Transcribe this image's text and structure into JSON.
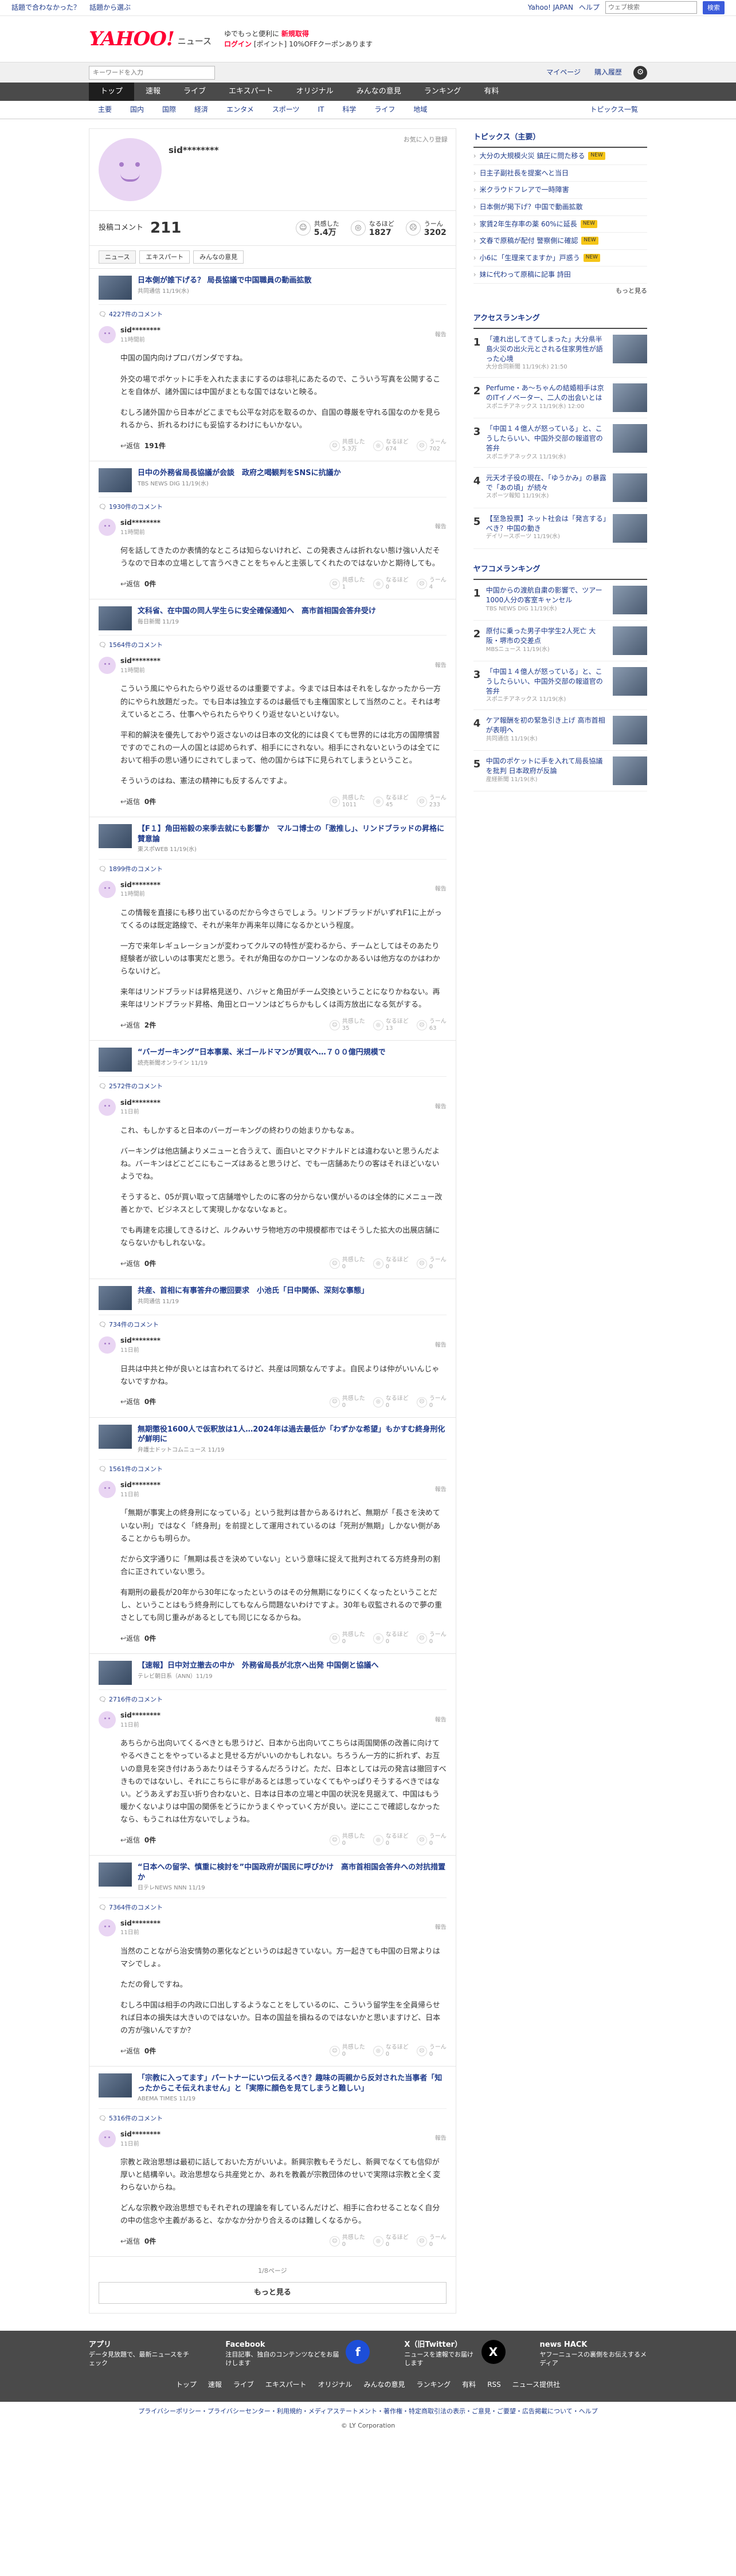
{
  "topbar": {
    "help1": "話題で合わなかった？",
    "help2": "話題から選ぶ",
    "right1": "Yahoo! JAPAN",
    "right2": "ヘルプ",
    "search_placeholder": "ウェブ検索",
    "search_btn": "検索"
  },
  "header": {
    "logo": "YAHOO!",
    "logo_sub": "ニュース",
    "promo1": "ゆでもっと便利に",
    "promo1b": "新規取得",
    "promo2": "ログイン",
    "promo2b": "[ポイント]",
    "promo2c": "10%OFFクーポンあります"
  },
  "searchbar": {
    "placeholder": "キーワードを入力",
    "my_page": "マイページ",
    "buy": "購入履歴"
  },
  "gnav": [
    "トップ",
    "速報",
    "ライブ",
    "エキスパート",
    "オリジナル",
    "みんなの意見",
    "ランキング",
    "有料"
  ],
  "snav": [
    "主要",
    "国内",
    "国際",
    "経済",
    "エンタメ",
    "スポーツ",
    "IT",
    "科学",
    "ライフ",
    "地域"
  ],
  "snav_right": "トピックス一覧",
  "profile": {
    "name": "sid********",
    "follow": "お気に入り登録",
    "posts_label": "投稿コメント",
    "posts": "211",
    "agree_label": "共感した",
    "agree": "5.4万",
    "hmm_label": "なるほど",
    "hmm": "1827",
    "bad_label": "うーん",
    "bad": "3202"
  },
  "tabs": [
    "ニュース",
    "エキスパート",
    "みんなの意見"
  ],
  "entries": [
    {
      "title": "日本側が誰下げる？ 局長協議で中国職員の動画拡散",
      "source": "共同通信 11/19(水)",
      "ccount": "4227件のコメント",
      "user": "sid********",
      "time": "11時間前",
      "report": "報告",
      "paras": [
        "中国の国内向けプロパガンダですね。",
        "外交の場でポケットに手を入れたままにするのは非礼にあたるので、こういう写真を公開することを自体が、諸外国には中国がまともな国ではないと映る。",
        "むしろ諸外国から日本がどこまでも公平な対応を取るのか、自国の尊厳を守れる国なのかを見られるから、折れるわけにも妥協するわけにもいかない。"
      ],
      "replies": "191件",
      "agree": "5.3万",
      "hmm": "674",
      "bad": "702"
    },
    {
      "title": "日中の外務省局長協議が会談　政府之喝観判をSNSに抗議か",
      "source": "TBS NEWS DIG 11/19(水)",
      "ccount": "1930件のコメント",
      "user": "sid********",
      "time": "11時間前",
      "report": "報告",
      "paras": [
        "何を話してきたのか表情的なところは知らないけれど、この発表さんは折れない態け強い人だそうなので日本の立場として言うべきことをちゃんと主張してくれたのではないかと期待しても。"
      ],
      "replies": "0件",
      "agree": "1",
      "hmm": "0",
      "bad": "4"
    },
    {
      "title": "文科省、在中国の同人学生らに安全確保通知へ　高市首相国会答弁受け",
      "source": "毎日新聞 11/19",
      "ccount": "1564件のコメント",
      "user": "sid********",
      "time": "11時間前",
      "report": "報告",
      "paras": [
        "こういう風にやられたらやり返せるのは重要ですよ。今までは日本はそれをしなかったから一方的にやられ放題だった。でも日本は独立するのは最低でも主権国家として当然のこと。それは考えているところ、仕事へやられたらやりくり返せないといけない。",
        "平和的解決を優先しておやり返さないのは日本の文化的には良くても世界的には北方の国際慣習ですのでこれの一人の国とは認められず、相手ににされない。相手にされないというのは全てにおいて相手の思い通りにされてしまって、他の国からは下に見られてしまうということ。",
        "そういうのはね、憲法の精神にも反するんですよ。"
      ],
      "replies": "0件",
      "agree": "1011",
      "hmm": "45",
      "bad": "233"
    },
    {
      "title": "【F１】角田裕毅の来季去就にも影響か　マルコ博士の「激推し」、リンドブラッドの昇格に賛意論",
      "source": "東スポWEB 11/19(水)",
      "ccount": "1899件のコメント",
      "user": "sid********",
      "time": "11時間前",
      "report": "報告",
      "paras": [
        "この情報を直接にも移り出ているのだから今さらでしょう。リンドブラッドがいずれF1に上がってくるのは既定路線で、それが来年か再来年以降になるかという程度。",
        "一方で来年レギュレーションが変わってクルマの特性が変わるから、チームとしてはそのあたり経験者が欲しいのは事実だと思う。それが角田なのかローソンなのかあるいは他方なのかはわからないけど。",
        "来年はリンドブラッドは昇格見送り、ハジャと角田がチーム交換ということになりかねない。再来年はリンドブラッド昇格、角田とローソンはどちらかもしくは両方放出になる気がする。"
      ],
      "replies": "2件",
      "agree": "35",
      "hmm": "13",
      "bad": "63"
    },
    {
      "title": "“バーガーキング”日本事業、米ゴールドマンが買収へ…７００億円規模で",
      "source": "読売新聞オンライン 11/19",
      "ccount": "2572件のコメント",
      "user": "sid********",
      "time": "11日前",
      "report": "報告",
      "paras": [
        "これ、もしかすると日本のバーガーキングの終わりの始まりかもなぁ。",
        "バーキングは他店舗よりメニューと合うえて、面白いとマクドナルドとは違わないと思うんだよね。バーキンはどこどこにもこーズはあると思うけど、でも一店舗あたりの客はそれほどいないようでね。",
        "そうすると、05が買い取って店舗増やしたのに客の分からない僕がいるのは全体的にメニュー改善とかで、ビジネスとして実現しかなないなぁと。",
        "でも再建を応援してきるけど、ルクみいサラ物地方の中規模都市ではそうした拡大の出展店舗にならないかもしれないな。"
      ],
      "replies": "0件",
      "agree": "0",
      "hmm": "0",
      "bad": "0"
    },
    {
      "title": "共産、首相に有事答弁の撤回要求　小池氏「日中関係、深刻な事態」",
      "source": "共同通信 11/19",
      "ccount": "734件のコメント",
      "user": "sid********",
      "time": "11日前",
      "report": "報告",
      "paras": [
        "日共は中共と仲が良いとは言われてるけど、共産は同類なんですよ。自民よりは仲がいいんじゃないですかね。"
      ],
      "replies": "0件",
      "agree": "0",
      "hmm": "0",
      "bad": "0"
    },
    {
      "title": "無期懲役1600人で仮釈放は1人…2024年は過去最低か「わずかな希望」もかすむ終身刑化が鮮明に",
      "source": "弁護士ドットコムニュース 11/19",
      "ccount": "1561件のコメント",
      "user": "sid********",
      "time": "11日前",
      "report": "報告",
      "paras": [
        "「無期が事実上の終身刑になっている」という批判は昔からあるけれど、無期が「長さを決めていない刑」ではなく「終身刑」を前提として運用されているのは「死刑が無期」しかない側があることからも明らか。",
        "だから文字通りに「無期は長さを決めていない」という意味に捉えて批判されてる方終身刑の割合に正されていない思う。",
        "有期刑の最長が20年から30年になったというのはその分無期になりにくくなったということだし、ということはもう終身刑にしてもなんら問題ないわけですよ。30年も収監されるので夢の重さとしても同じ重みがあるとしても同じになるからね。"
      ],
      "replies": "0件",
      "agree": "0",
      "hmm": "0",
      "bad": "0"
    },
    {
      "title": "【速報】日中対立撤去の中か　外務省局長が北京へ出発 中国側と協議へ",
      "source": "テレビ朝日系（ANN）11/19",
      "ccount": "2716件のコメント",
      "user": "sid********",
      "time": "11日前",
      "report": "報告",
      "paras": [
        "あちらから出向いてくるべきとも思うけど、日本から出向いてこちらは両国関係の改善に向けてやるべきことをやっているよと見せる方がいいのかもしれない。ちろうん一方的に折れず、お互いの意見を突き付けあうあたりはそうするんだろうけど。ただ、日本としては元の発言は撤回すべきものではないし、それにこちらに非があるとは思っていなくてもやっぱりそうするべきではない。どうあえずお互い折り合わないと、日本は日本の立場と中国の状況を見据えて、中国はもう暖かくないよりは中国の関係をどうにかうまくやっていく方が良い。逆にここで確認しなかったなら、もうこれは仕方ないでしょうね。"
      ],
      "replies": "0件",
      "agree": "0",
      "hmm": "0",
      "bad": "0"
    },
    {
      "title": "“日本への留学、慎重に検討を”中国政府が国民に呼びかけ　高市首相国会答弁への対抗措置か",
      "source": "日テレNEWS NNN 11/19",
      "ccount": "7364件のコメント",
      "user": "sid********",
      "time": "11日前",
      "report": "報告",
      "paras": [
        "当然のことながら治安情勢の悪化などというのは起きていない。方一起きても中国の日常よりはマシでしょ。",
        "ただの脅しですね。",
        "むしろ中国は相手の内政に口出しするようなことをしているのに、こういう留学生を全員帰らせれば日本の損失は大きいのではないか。日本の国益を損ねるのではないかと思いますけど、日本の方が強いんですか？"
      ],
      "replies": "0件",
      "agree": "0",
      "hmm": "0",
      "bad": "0"
    },
    {
      "title": "「宗教に入ってます」パートナーにいつ伝えるべき？趣味の両親から反対された当事者「知ったからこそ伝えれません」と「実際に顔色を見てしまうと難しい」",
      "source": "ABEMA TIMES 11/19",
      "ccount": "5316件のコメント",
      "user": "sid********",
      "time": "11日前",
      "report": "報告",
      "paras": [
        "宗教と政治思想は最初に話しておいた方がいいよ。新興宗教もそうだし、新興でなくても信仰が厚いと結構辛い。政治思想なら共産党とか、あれを教義が宗教団体のせいで実際は宗教と全く変わらないからね。",
        "どんな宗教や政治思想でもそれぞれの理論を有しているんだけど、相手に合わせることなく自分の中の信念や主義があると、なかなか分かり合えるのは難しくなるから。"
      ],
      "replies": "0件",
      "agree": "0",
      "hmm": "0",
      "bad": "0"
    }
  ],
  "pager": "1/8ページ",
  "more": "もっと見る",
  "topics": {
    "title": "トピックス（主要）",
    "new": "NEW",
    "more": "もっと見る",
    "items": [
      "大分の大規模火災 鎮圧に問た移る",
      "日主子副社長を提案へと当日",
      "米クラウドフレアで一時障害",
      "日本側が掲下げ？中国で動画拡散",
      "家賃2年生存率の薬 60%に延長",
      "文春で原稿が配付 警察側に確認",
      "小6に「生理来てますか」戸惑う",
      "妹に代わって原稿に記事 詩田"
    ]
  },
  "access": {
    "title": "アクセスランキング",
    "items": [
      {
        "n": "1",
        "t": "「連れ出してきてしまった」大分県半島火災の出火元とされる住家男性が語った心境",
        "s": "大分合同新聞 11/19(水) 21:50"
      },
      {
        "n": "2",
        "t": "Perfume・あ～ちゃんの結婚相手は京のITイノベーター、二人の出会いとは",
        "s": "スポニチアネックス 11/19(水) 12:00"
      },
      {
        "n": "3",
        "t": "「中国１４億人が怒っている」と、こうしたらいい、中国外交部の報道官の答弁",
        "s": "スポニチアネックス 11/19(水)"
      },
      {
        "n": "4",
        "t": "元天才子役の現在、「ゆうかみ」の暴露で「あの頃」が続々",
        "s": "スポーツ報知 11/19(水)"
      },
      {
        "n": "5",
        "t": "【至急投票】ネット社会は「発言する」べき？中国の動き",
        "s": "デイリースポーツ 11/19(水)"
      }
    ]
  },
  "yahoo_rank": {
    "title": "ヤフコメランキング",
    "items": [
      {
        "n": "1",
        "t": "中国からの渡航自粛の影響で、ツアー1000人分の客室キャンセル",
        "s": "TBS NEWS DIG 11/19(水)"
      },
      {
        "n": "2",
        "t": "原付に乗った男子中学生2人死亡 大阪・堺市の交差点",
        "s": "MBSニュース 11/19(水)"
      },
      {
        "n": "3",
        "t": "「中国１４億人が怒っている」と、こうしたらいい、中国外交部の報道官の答弁",
        "s": "スポニチアネックス 11/19(水)"
      },
      {
        "n": "4",
        "t": "ケア報酬を初の緊急引き上げ 高市首相が表明へ",
        "s": "共同通信 11/19(水)"
      },
      {
        "n": "5",
        "t": "中国のポケットに手を入れて局長協議を批判 日本政府が反論",
        "s": "産経新聞 11/19(水)"
      }
    ]
  },
  "footer": {
    "app_t": "アプリ",
    "app_s": "データ見放題で、最新ニュースをチェック",
    "fb_t": "Facebook",
    "fb_s": "注目記事、独自のコンテンツなどをお届けします",
    "x_t": "X（旧Twitter）",
    "x_s": "ニュースを速報でお届けします",
    "nh_t": "news HACK",
    "nh_s": "ヤフーニュースの裏側をお伝えするメディア",
    "nav": [
      "トップ",
      "速報",
      "ライブ",
      "エキスパート",
      "オリジナル",
      "みんなの意見",
      "ランキング",
      "有料",
      "RSS",
      "ニュース提供社"
    ],
    "legal": "プライバシーポリシー・プライバシーセンター・利用規約・メディアステートメント・著作権・特定商取引法の表示・ご意見・ご要望・広告掲載について・ヘルプ",
    "copy": "© LY Corporation"
  }
}
